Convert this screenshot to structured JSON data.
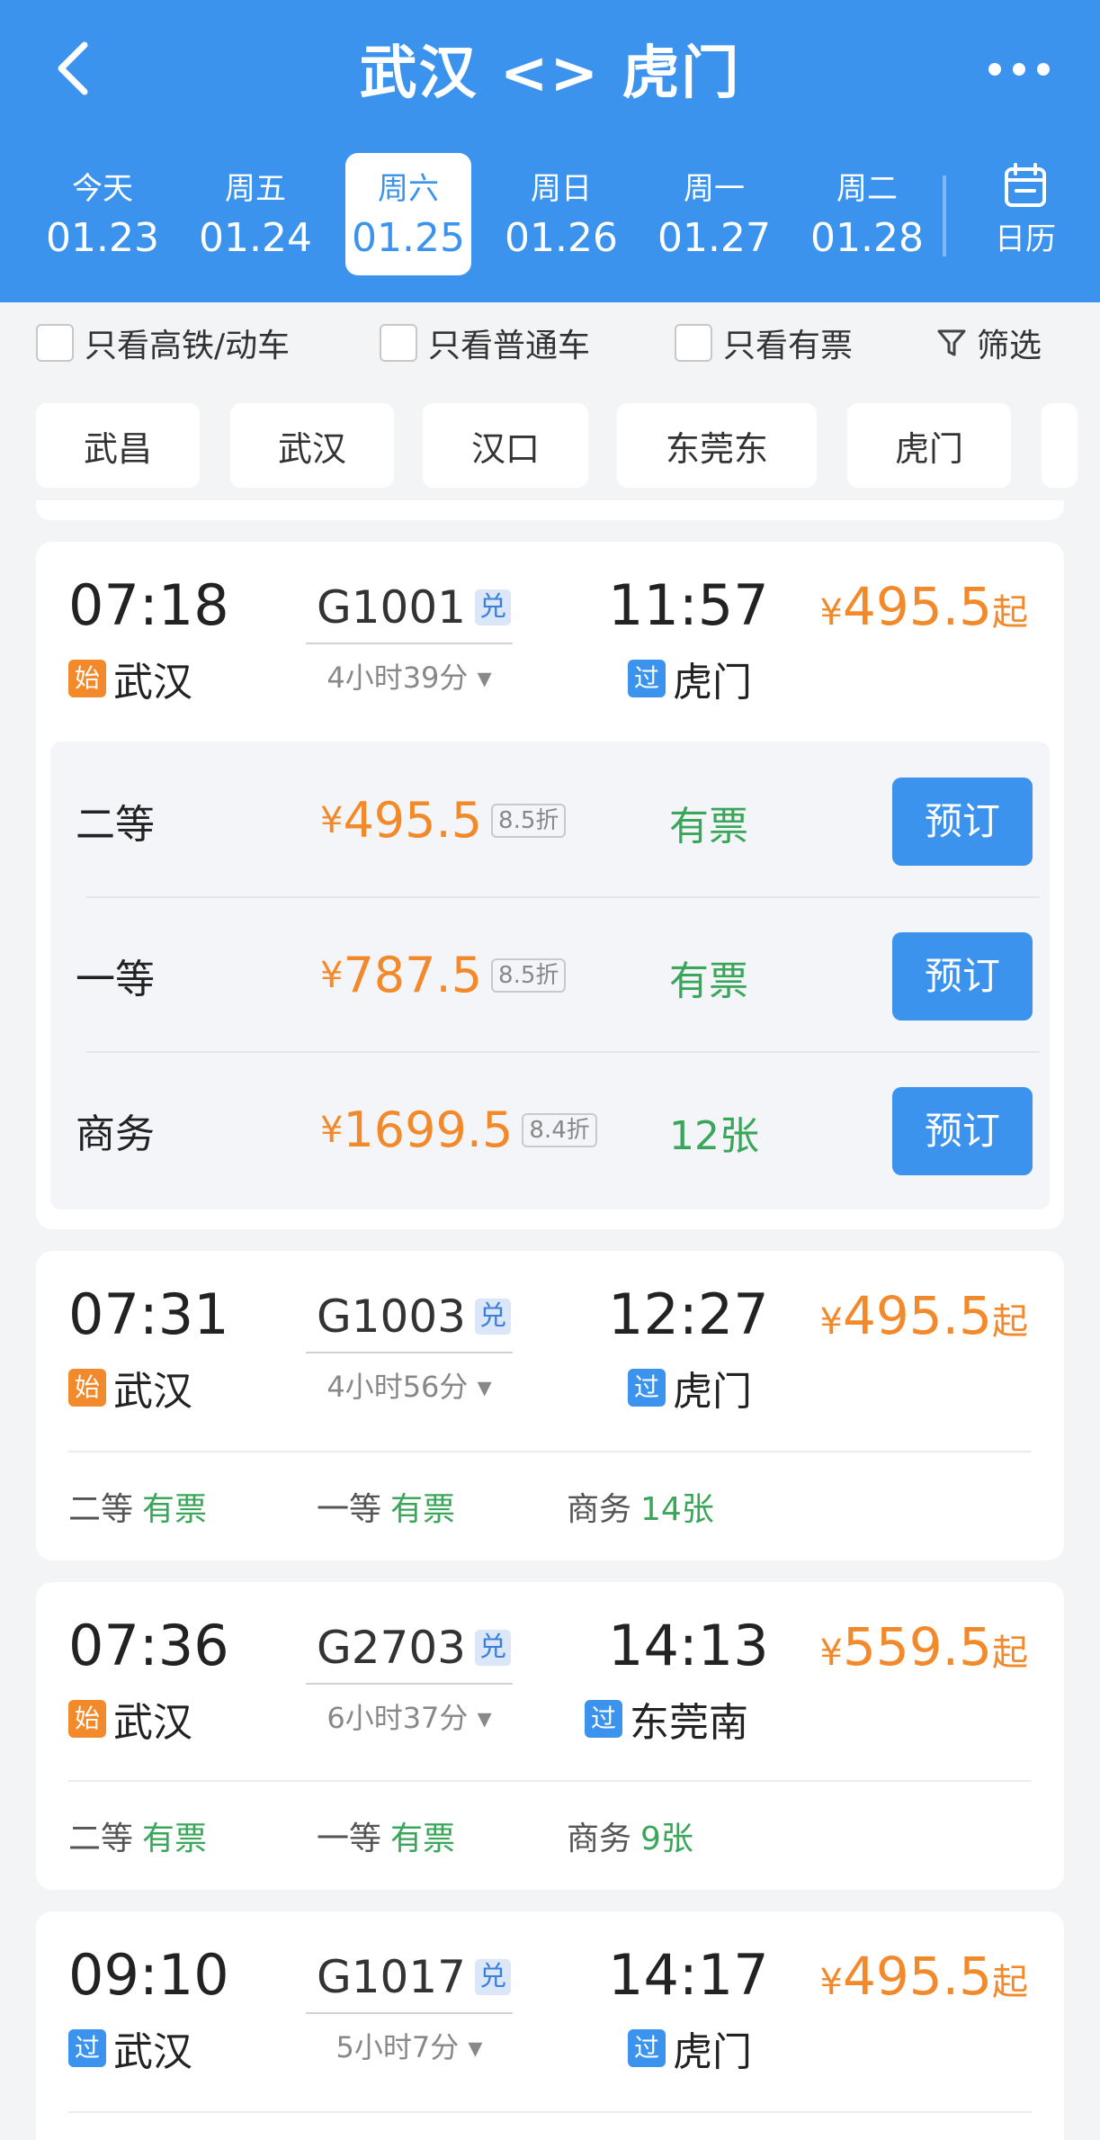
{
  "header": {
    "title": "武汉 <> 虎门",
    "dates": [
      {
        "weekday": "今天",
        "date": "01.23"
      },
      {
        "weekday": "周五",
        "date": "01.24"
      },
      {
        "weekday": "周六",
        "date": "01.25"
      },
      {
        "weekday": "周日",
        "date": "01.26"
      },
      {
        "weekday": "周一",
        "date": "01.27"
      },
      {
        "weekday": "周二",
        "date": "01.28"
      }
    ],
    "selected_date_index": 2,
    "calendar_label": "日历"
  },
  "filters": {
    "high_speed_only": "只看高铁/动车",
    "regular_only": "只看普通车",
    "available_only": "只看有票",
    "filter_label": "筛选"
  },
  "stations": [
    "武昌",
    "武汉",
    "汉口",
    "东莞东",
    "虎门"
  ],
  "trains": [
    {
      "depart_time": "07:18",
      "train_no": "G1001",
      "badge": "兑",
      "duration": "4小时39分",
      "arrive_time": "11:57",
      "from_tag": "始",
      "from": "武汉",
      "to_tag": "过",
      "to": "虎门",
      "price_symbol": "¥",
      "price": "495.5",
      "price_suffix": "起",
      "seats": [
        {
          "name": "二等",
          "symbol": "¥",
          "price": "495.5",
          "discount": "8.5折",
          "avail": "有票",
          "book": "预订"
        },
        {
          "name": "一等",
          "symbol": "¥",
          "price": "787.5",
          "discount": "8.5折",
          "avail": "有票",
          "book": "预订"
        },
        {
          "name": "商务",
          "symbol": "¥",
          "price": "1699.5",
          "discount": "8.4折",
          "avail": "12张",
          "book": "预订"
        }
      ]
    },
    {
      "depart_time": "07:31",
      "train_no": "G1003",
      "badge": "兑",
      "duration": "4小时56分",
      "arrive_time": "12:27",
      "from_tag": "始",
      "from": "武汉",
      "to_tag": "过",
      "to": "虎门",
      "price_symbol": "¥",
      "price": "495.5",
      "price_suffix": "起",
      "summary": [
        {
          "name": "二等",
          "avail": "有票"
        },
        {
          "name": "一等",
          "avail": "有票"
        },
        {
          "name": "商务",
          "avail": "14张"
        }
      ]
    },
    {
      "depart_time": "07:36",
      "train_no": "G2703",
      "badge": "兑",
      "duration": "6小时37分",
      "arrive_time": "14:13",
      "from_tag": "始",
      "from": "武汉",
      "to_tag": "过",
      "to": "东莞南",
      "price_symbol": "¥",
      "price": "559.5",
      "price_suffix": "起",
      "summary": [
        {
          "name": "二等",
          "avail": "有票"
        },
        {
          "name": "一等",
          "avail": "有票"
        },
        {
          "name": "商务",
          "avail": "9张"
        }
      ]
    },
    {
      "depart_time": "09:10",
      "train_no": "G1017",
      "badge": "兑",
      "duration": "5小时7分",
      "arrive_time": "14:17",
      "from_tag": "过",
      "from": "武汉",
      "to_tag": "过",
      "to": "虎门",
      "price_symbol": "¥",
      "price": "495.5",
      "price_suffix": "起"
    }
  ],
  "colors": {
    "primary": "#3b93ee",
    "price": "#f28a2b",
    "available": "#3aa65a",
    "background": "#f3f4f6"
  }
}
